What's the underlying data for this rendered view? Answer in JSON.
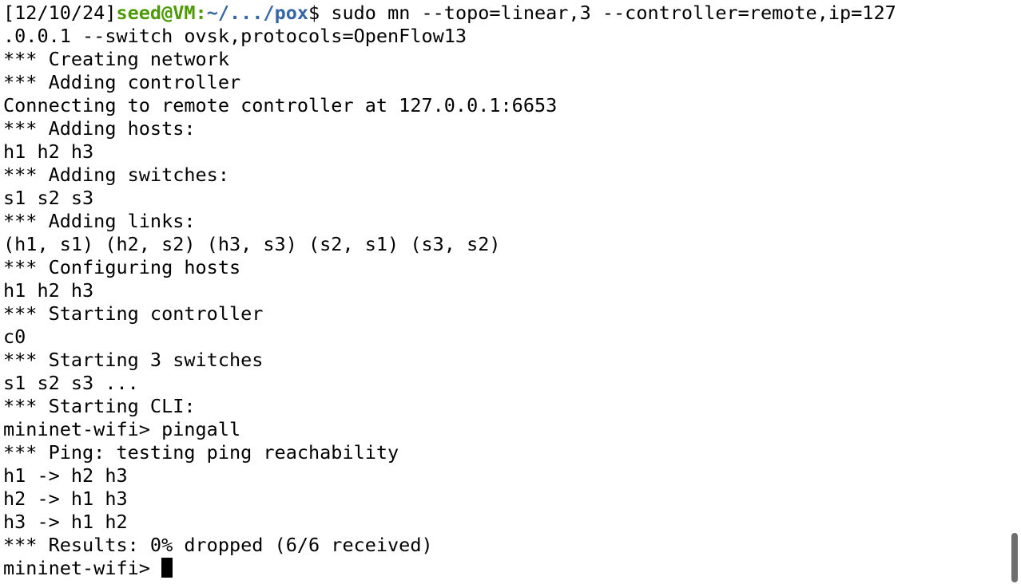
{
  "prompt": {
    "timestamp": "[12/10/24]",
    "user_host": "seed@VM",
    "colon": ":",
    "path": "~/.../pox",
    "dollar": "$ ",
    "command": "sudo mn --topo=linear,3 --controller=remote,ip=127"
  },
  "output_lines": [
    ".0.0.1 --switch ovsk,protocols=OpenFlow13",
    "*** Creating network",
    "*** Adding controller",
    "Connecting to remote controller at 127.0.0.1:6653",
    "*** Adding hosts:",
    "h1 h2 h3",
    "*** Adding switches:",
    "s1 s2 s3",
    "*** Adding links:",
    "(h1, s1) (h2, s2) (h3, s3) (s2, s1) (s3, s2)",
    "*** Configuring hosts",
    "h1 h2 h3",
    "*** Starting controller",
    "c0",
    "*** Starting 3 switches",
    "s1 s2 s3 ...",
    "*** Starting CLI:",
    "mininet-wifi> pingall",
    "*** Ping: testing ping reachability",
    "h1 -> h2 h3",
    "h2 -> h1 h3",
    "h3 -> h1 h2",
    "*** Results: 0% dropped (6/6 received)"
  ],
  "current_prompt": "mininet-wifi> ",
  "colors": {
    "background": "#ffffff",
    "text": "#000000",
    "user_host": "#4e9a06",
    "path": "#3465a4"
  }
}
